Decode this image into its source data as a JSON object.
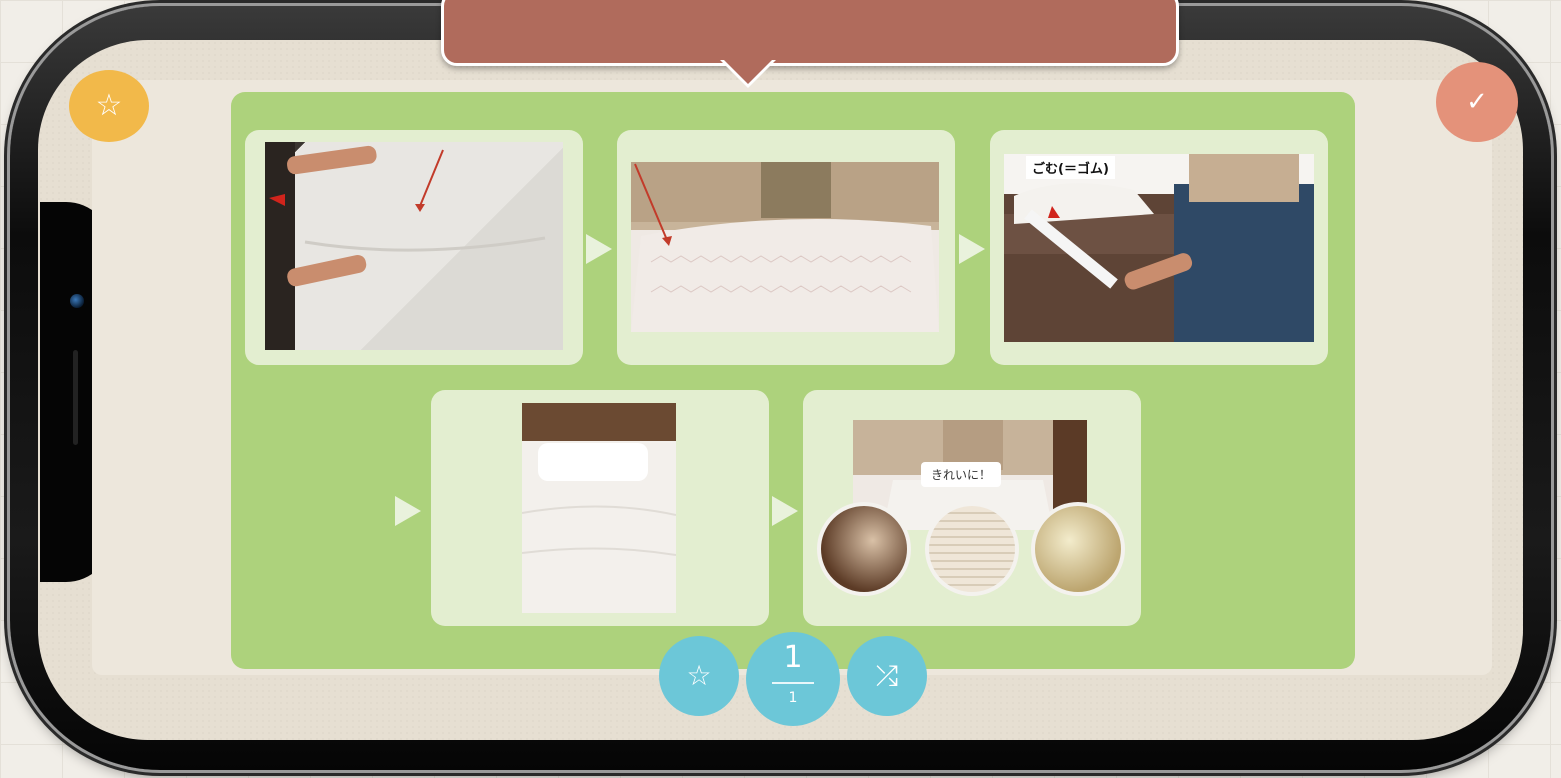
{
  "callout": {
    "text": ""
  },
  "buttons": {
    "favorite_icon": "☆",
    "done_icon": "✓",
    "bottom_star_icon": "☆",
    "shuffle_icon": "⤮"
  },
  "pagination": {
    "current": "1",
    "total": "1"
  },
  "steps": [
    {
      "tag": ""
    },
    {
      "tag": ""
    },
    {
      "tag": "ごむ(＝ゴム)"
    },
    {
      "tag": ""
    },
    {
      "tag": "",
      "bubble": "きれいに！"
    }
  ],
  "colors": {
    "panel": "#add27c",
    "step_card": "#e3eed0",
    "callout": "#b06b5c",
    "favorite": "#f2b94a",
    "done": "#e4927a",
    "controls": "#6cc7d8"
  }
}
